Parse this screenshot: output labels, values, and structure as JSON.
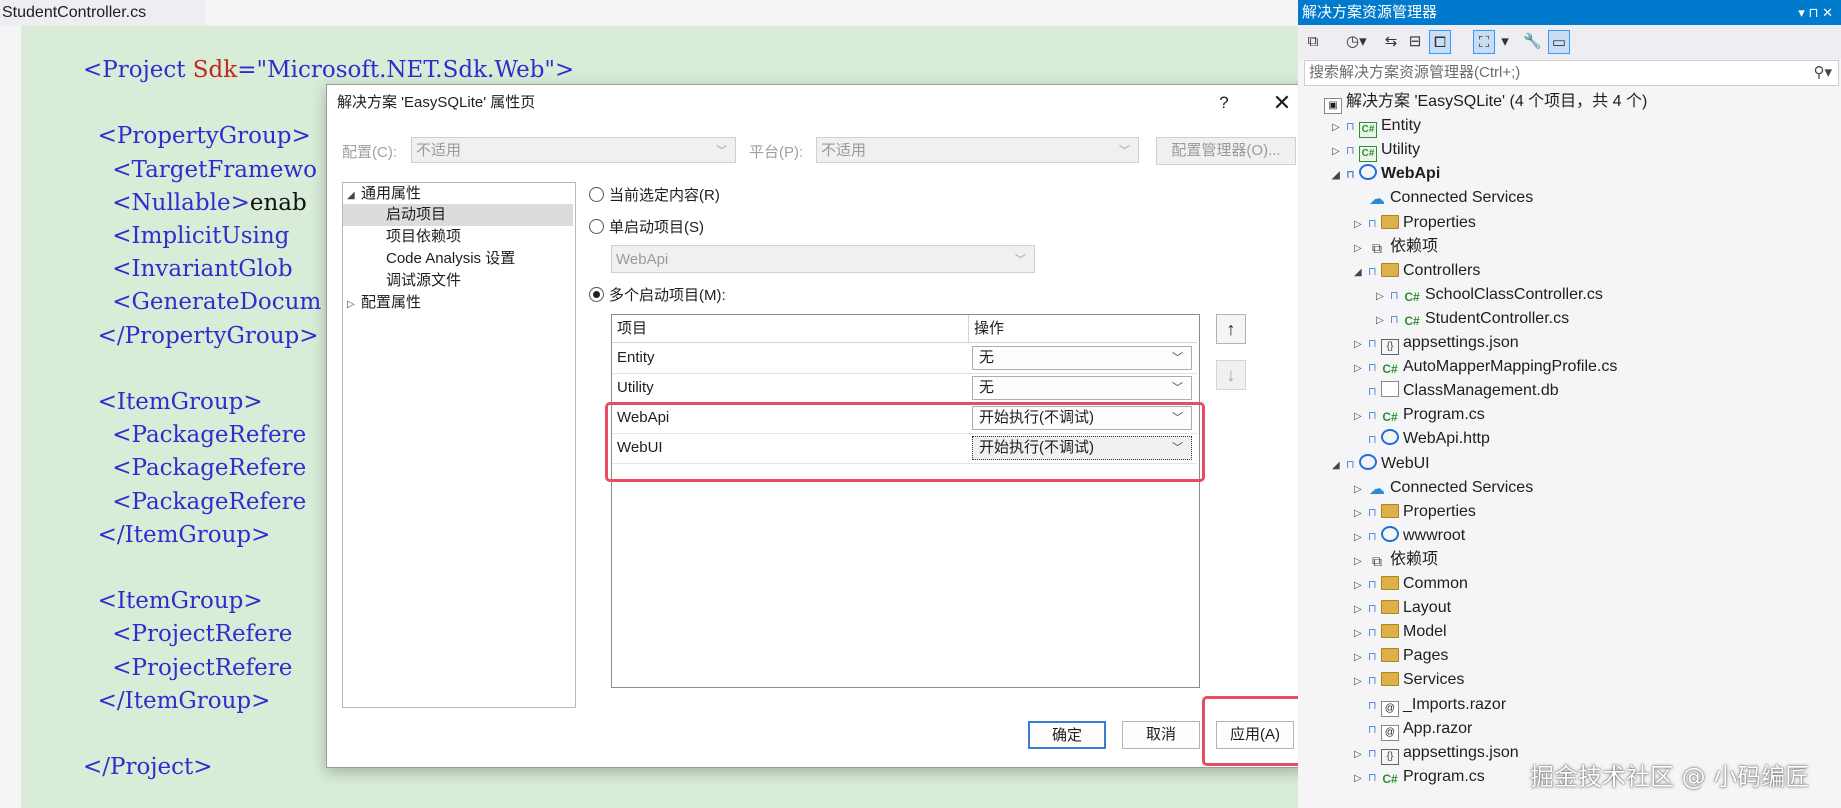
{
  "editor": {
    "tab_label": "StudentController.cs",
    "lines": [
      [
        {
          "c": "tag",
          "t": "<Project "
        },
        {
          "c": "attr",
          "t": "Sdk"
        },
        {
          "c": "tag",
          "t": "="
        },
        {
          "c": "val",
          "t": "\"Microsoft.NET.Sdk.Web\""
        },
        {
          "c": "tag",
          "t": ">"
        }
      ],
      [],
      [
        {
          "c": "tag",
          "t": "  <PropertyGroup>"
        }
      ],
      [
        {
          "c": "tag",
          "t": "    <TargetFramewo"
        }
      ],
      [
        {
          "c": "tag",
          "t": "    <Nullable>"
        },
        {
          "c": "txt",
          "t": "enab"
        }
      ],
      [
        {
          "c": "tag",
          "t": "    <ImplicitUsing"
        }
      ],
      [
        {
          "c": "tag",
          "t": "    <InvariantGlob"
        }
      ],
      [
        {
          "c": "tag",
          "t": "    <GenerateDocum"
        }
      ],
      [
        {
          "c": "tag",
          "t": "  </PropertyGroup>"
        }
      ],
      [],
      [
        {
          "c": "tag",
          "t": "  <ItemGroup>"
        }
      ],
      [
        {
          "c": "tag",
          "t": "    <PackageRefere"
        }
      ],
      [
        {
          "c": "tag",
          "t": "    <PackageRefere"
        }
      ],
      [
        {
          "c": "tag",
          "t": "    <PackageRefere"
        }
      ],
      [
        {
          "c": "tag",
          "t": "  </ItemGroup>"
        }
      ],
      [],
      [
        {
          "c": "tag",
          "t": "  <ItemGroup>"
        }
      ],
      [
        {
          "c": "tag",
          "t": "    <ProjectRefere"
        }
      ],
      [
        {
          "c": "tag",
          "t": "    <ProjectRefere"
        }
      ],
      [
        {
          "c": "tag",
          "t": "  </ItemGroup>"
        }
      ],
      [],
      [
        {
          "c": "tag",
          "t": "</Project>"
        }
      ]
    ]
  },
  "dialog": {
    "title": "解决方案 'EasySQLite' 属性页",
    "help": "?",
    "close": "✕",
    "config_label": "配置(C):",
    "config_value": "不适用",
    "platform_label": "平台(P):",
    "platform_value": "不适用",
    "config_manager": "配置管理器(O)...",
    "tree": [
      {
        "label": "通用属性",
        "expander": "◢"
      },
      {
        "label": "启动项目",
        "expander": ""
      },
      {
        "label": "项目依赖项",
        "expander": ""
      },
      {
        "label": "Code Analysis 设置",
        "expander": ""
      },
      {
        "label": "调试源文件",
        "expander": ""
      },
      {
        "label": "配置属性",
        "expander": "▷"
      }
    ],
    "radio_current": "当前选定内容(R)",
    "radio_single": "单启动项目(S)",
    "single_value": "WebApi",
    "radio_multi": "多个启动项目(M):",
    "grid_headers": [
      "项目",
      "操作"
    ],
    "grid_rows": [
      {
        "project": "Entity",
        "action": "无"
      },
      {
        "project": "Utility",
        "action": "无"
      },
      {
        "project": "WebApi",
        "action": "开始执行(不调试)"
      },
      {
        "project": "WebUI",
        "action": "开始执行(不调试)"
      }
    ],
    "up_arrow": "↑",
    "down_arrow": "↓",
    "ok": "确定",
    "cancel": "取消",
    "apply": "应用(A)",
    "highlight_color": "#e84c5e"
  },
  "solution_explorer": {
    "title": "解决方案资源管理器",
    "title_controls": "▾ ⊓ ✕",
    "search_placeholder": "搜索解决方案资源管理器(Ctrl+;)",
    "accent": "#007acc",
    "items": [
      {
        "label": "解决方案 'EasySQLite' (4 个项目，共 4 个)",
        "indent": 0,
        "expander": "",
        "icon": "solution-icon",
        "lock": false,
        "bold": false
      },
      {
        "label": "Entity",
        "indent": 1,
        "expander": "▷",
        "icon": "csproj-icon",
        "lock": true,
        "bold": false
      },
      {
        "label": "Utility",
        "indent": 1,
        "expander": "▷",
        "icon": "csproj-icon",
        "lock": true,
        "bold": false
      },
      {
        "label": "WebApi",
        "indent": 1,
        "expander": "◢",
        "icon": "web-project-icon",
        "lock": true,
        "bold": true
      },
      {
        "label": "Connected Services",
        "indent": 2,
        "expander": "",
        "icon": "cloud-icon",
        "lock": false,
        "bold": false
      },
      {
        "label": "Properties",
        "indent": 2,
        "expander": "▷",
        "icon": "properties-folder-icon",
        "lock": true,
        "bold": false
      },
      {
        "label": "依赖项",
        "indent": 2,
        "expander": "▷",
        "icon": "dependencies-icon",
        "lock": false,
        "bold": false
      },
      {
        "label": "Controllers",
        "indent": 2,
        "expander": "◢",
        "icon": "folder-icon",
        "lock": true,
        "bold": false
      },
      {
        "label": "SchoolClassController.cs",
        "indent": 3,
        "expander": "▷",
        "icon": "csharp-file-icon",
        "lock": true,
        "bold": false
      },
      {
        "label": "StudentController.cs",
        "indent": 3,
        "expander": "▷",
        "icon": "csharp-file-icon",
        "lock": true,
        "bold": false
      },
      {
        "label": "appsettings.json",
        "indent": 2,
        "expander": "▷",
        "icon": "json-file-icon",
        "lock": true,
        "bold": false
      },
      {
        "label": "AutoMapperMappingProfile.cs",
        "indent": 2,
        "expander": "▷",
        "icon": "csharp-file-icon",
        "lock": true,
        "bold": false
      },
      {
        "label": "ClassManagement.db",
        "indent": 2,
        "expander": "",
        "icon": "db-file-icon",
        "lock": true,
        "bold": false
      },
      {
        "label": "Program.cs",
        "indent": 2,
        "expander": "▷",
        "icon": "csharp-file-icon",
        "lock": true,
        "bold": false
      },
      {
        "label": "WebApi.http",
        "indent": 2,
        "expander": "",
        "icon": "http-file-icon",
        "lock": true,
        "bold": false
      },
      {
        "label": "WebUI",
        "indent": 1,
        "expander": "◢",
        "icon": "web-project-icon",
        "lock": true,
        "bold": false
      },
      {
        "label": "Connected Services",
        "indent": 2,
        "expander": "▷",
        "icon": "cloud-icon",
        "lock": false,
        "bold": false
      },
      {
        "label": "Properties",
        "indent": 2,
        "expander": "▷",
        "icon": "properties-folder-icon",
        "lock": true,
        "bold": false
      },
      {
        "label": "wwwroot",
        "indent": 2,
        "expander": "▷",
        "icon": "globe-icon",
        "lock": true,
        "bold": false
      },
      {
        "label": "依赖项",
        "indent": 2,
        "expander": "▷",
        "icon": "dependencies-icon",
        "lock": false,
        "bold": false
      },
      {
        "label": "Common",
        "indent": 2,
        "expander": "▷",
        "icon": "folder-icon",
        "lock": true,
        "bold": false
      },
      {
        "label": "Layout",
        "indent": 2,
        "expander": "▷",
        "icon": "folder-icon",
        "lock": true,
        "bold": false
      },
      {
        "label": "Model",
        "indent": 2,
        "expander": "▷",
        "icon": "folder-icon",
        "lock": true,
        "bold": false
      },
      {
        "label": "Pages",
        "indent": 2,
        "expander": "▷",
        "icon": "folder-icon",
        "lock": true,
        "bold": false
      },
      {
        "label": "Services",
        "indent": 2,
        "expander": "▷",
        "icon": "folder-icon",
        "lock": true,
        "bold": false
      },
      {
        "label": "_Imports.razor",
        "indent": 2,
        "expander": "",
        "icon": "razor-file-icon",
        "lock": true,
        "bold": false
      },
      {
        "label": "App.razor",
        "indent": 2,
        "expander": "",
        "icon": "razor-file-icon",
        "lock": true,
        "bold": false
      },
      {
        "label": "appsettings.json",
        "indent": 2,
        "expander": "▷",
        "icon": "json-file-icon",
        "lock": true,
        "bold": false
      },
      {
        "label": "Program.cs",
        "indent": 2,
        "expander": "▷",
        "icon": "csharp-file-icon",
        "lock": true,
        "bold": false
      }
    ]
  },
  "watermark": "掘金技术社区 @ 小码编匠"
}
